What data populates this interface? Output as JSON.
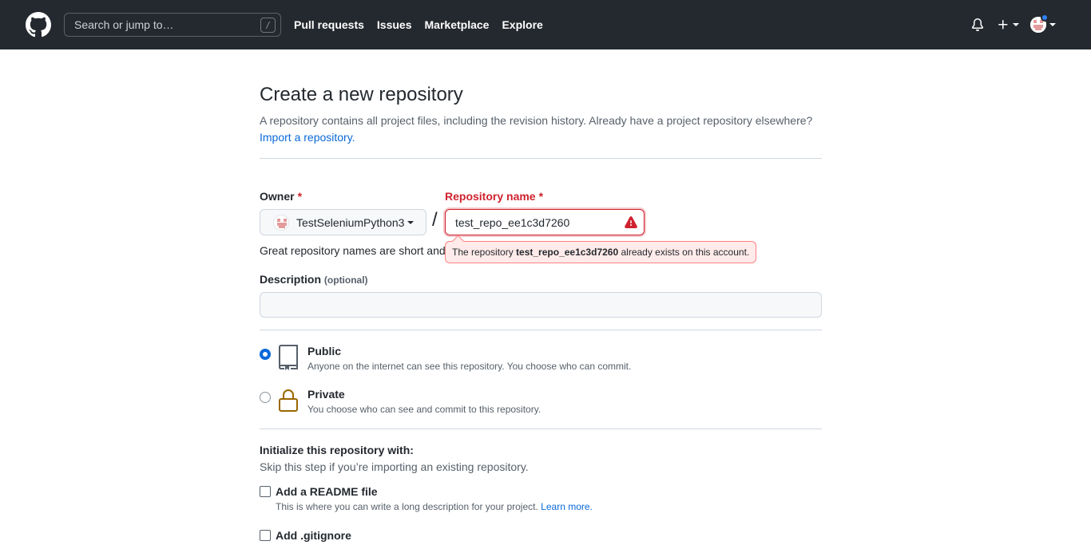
{
  "header": {
    "search_placeholder": "Search or jump to…",
    "search_shortcut": "/",
    "nav": [
      "Pull requests",
      "Issues",
      "Marketplace",
      "Explore"
    ],
    "icons": [
      "github-logo-icon",
      "bell-icon",
      "plus-icon",
      "avatar"
    ]
  },
  "page": {
    "title": "Create a new repository",
    "subtitle": "A repository contains all project files, including the revision history. Already have a project repository elsewhere?",
    "import_link": "Import a repository."
  },
  "form": {
    "owner_label": "Owner",
    "required_mark": "*",
    "owner_value": "TestSeleniumPython3",
    "separator": "/",
    "repo_label": "Repository name",
    "repo_value": "test_repo_ee1c3d7260",
    "great_names": "Great repository names are short and",
    "error_prefix": "The repository",
    "error_name": "test_repo_ee1c3d7260",
    "error_suffix": "already exists on this account.",
    "description_label": "Description",
    "description_optional": "(optional)",
    "description_value": ""
  },
  "visibility": {
    "options": [
      {
        "title": "Public",
        "desc": "Anyone on the internet can see this repository. You choose who can commit.",
        "checked": true
      },
      {
        "title": "Private",
        "desc": "You choose who can see and commit to this repository.",
        "checked": false
      }
    ]
  },
  "init": {
    "title": "Initialize this repository with:",
    "subtitle": "Skip this step if you’re importing an existing repository.",
    "readme_title": "Add a README file",
    "readme_desc": "This is where you can write a long description for your project.",
    "readme_learn_more": "Learn more.",
    "gitignore_title": "Add .gitignore"
  },
  "colors": {
    "header_bg": "#24292f",
    "link": "#0969da",
    "error": "#cf222e",
    "error_bg": "#ffebe9",
    "lock": "#9a6700"
  }
}
